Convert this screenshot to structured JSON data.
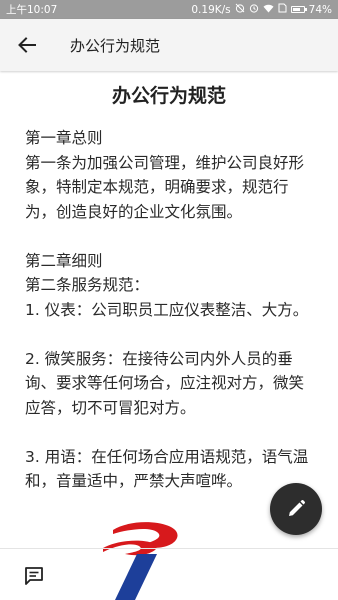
{
  "status_bar": {
    "time": "上午10:07",
    "network_speed": "0.19K/s",
    "battery_percent": "74%",
    "battery_level": 0.74,
    "icons": [
      "alarm-off-icon",
      "alarm-clock-icon",
      "wifi-icon",
      "sim-icon",
      "battery-icon"
    ]
  },
  "app_bar": {
    "title": "办公行为规范",
    "back_icon": "arrow-left-icon"
  },
  "document": {
    "title": "办公行为规范",
    "paragraphs": [
      "第一章总则\n第一条为加强公司管理，维护公司良好形象，特制定本规范，明确要求，规范行为，创造良好的企业文化氛围。",
      "第二章细则\n第二条服务规范：\n1. 仪表：公司职员工应仪表整洁、大方。",
      "2. 微笑服务：在接待公司内外人员的垂询、要求等任何场合，应注视对方，微笑应答，切不可冒犯对方。",
      "3. 用语：在任何场合应用语规范，语气温和，音量适中，严禁大声喧哗。"
    ]
  },
  "fab": {
    "icon": "pencil-edit-icon"
  },
  "bottom_bar": {
    "icon": "comment-icon"
  },
  "colors": {
    "status_bar": "#9c9c9c",
    "app_bar": "#f4f4f4",
    "fab": "#2d2d2d",
    "logo_red": "#d7191c",
    "logo_blue": "#1d3f9a"
  }
}
